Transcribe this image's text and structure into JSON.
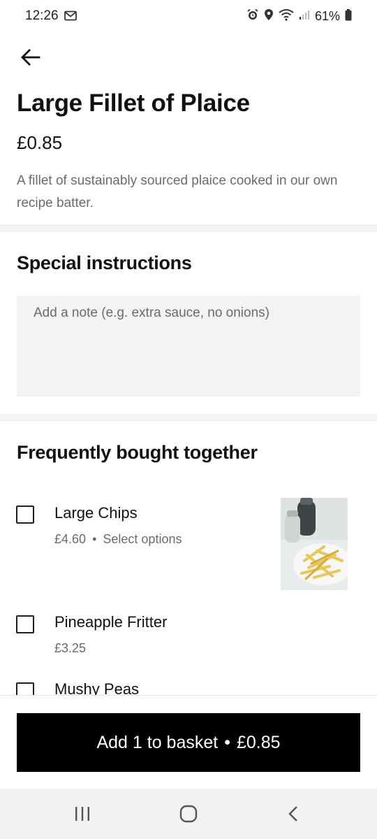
{
  "status_bar": {
    "time": "12:26",
    "battery": "61%",
    "icons": [
      "mail-icon",
      "alarm-icon",
      "location-icon",
      "wifi-icon",
      "signal-icon",
      "battery-icon"
    ]
  },
  "product": {
    "title": "Large Fillet of Plaice",
    "price": "£0.85",
    "description": "A fillet of sustainably sourced plaice cooked in our own recipe batter."
  },
  "special_instructions": {
    "title": "Special instructions",
    "placeholder": "Add a note (e.g. extra sauce, no onions)"
  },
  "frequently_bought": {
    "title": "Frequently bought together",
    "items": [
      {
        "name": "Large Chips",
        "price": "£4.60",
        "separator": "•",
        "options": "Select options",
        "checked": false,
        "has_image": true
      },
      {
        "name": "Pineapple Fritter",
        "price": "£3.25",
        "checked": false
      },
      {
        "name": "Mushy Peas",
        "checked": false
      }
    ]
  },
  "add_button": {
    "label": "Add 1 to basket",
    "separator": "•",
    "price": "£0.85"
  },
  "colors": {
    "primary": "#000000",
    "secondary_text": "#6b6b6b",
    "divider": "#f3f3f3"
  }
}
